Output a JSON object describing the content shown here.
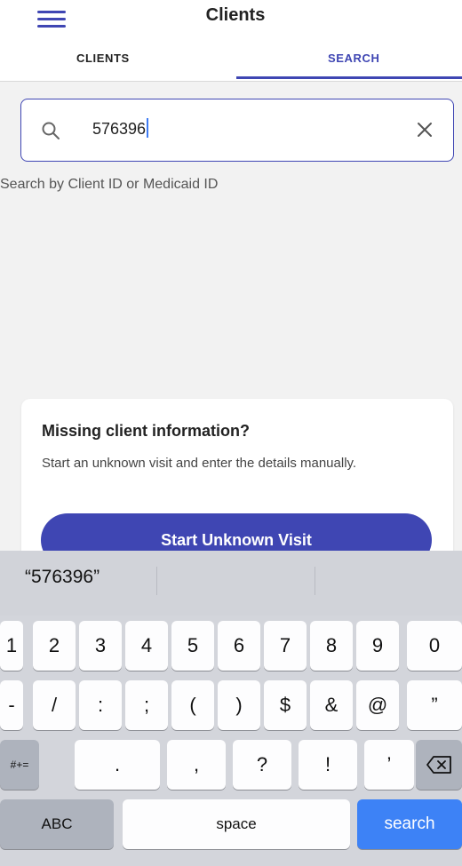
{
  "header": {
    "title": "Clients",
    "tabs": [
      "CLIENTS",
      "SEARCH"
    ],
    "active_tab": "SEARCH"
  },
  "search": {
    "value": "576396",
    "hint": "Search by Client ID or Medicaid ID"
  },
  "card": {
    "title": "Missing client information?",
    "description": "Start an unknown visit and enter the details manually.",
    "button_label": "Start Unknown Visit"
  },
  "keyboard": {
    "suggestion": "“576396”",
    "row1": [
      "1",
      "2",
      "3",
      "4",
      "5",
      "6",
      "7",
      "8",
      "9",
      "0"
    ],
    "row2": [
      "-",
      "/",
      ":",
      ";",
      "(",
      ")",
      "$",
      "&",
      "@",
      "”"
    ],
    "row3": [
      ".",
      ",",
      "?",
      "!",
      "’"
    ],
    "mode_key": "#+=",
    "abc_key": "ABC",
    "space_key": "space",
    "search_key": "search"
  },
  "colors": {
    "accent": "#3f46b3",
    "keyboard_blue": "#3d82f6"
  }
}
